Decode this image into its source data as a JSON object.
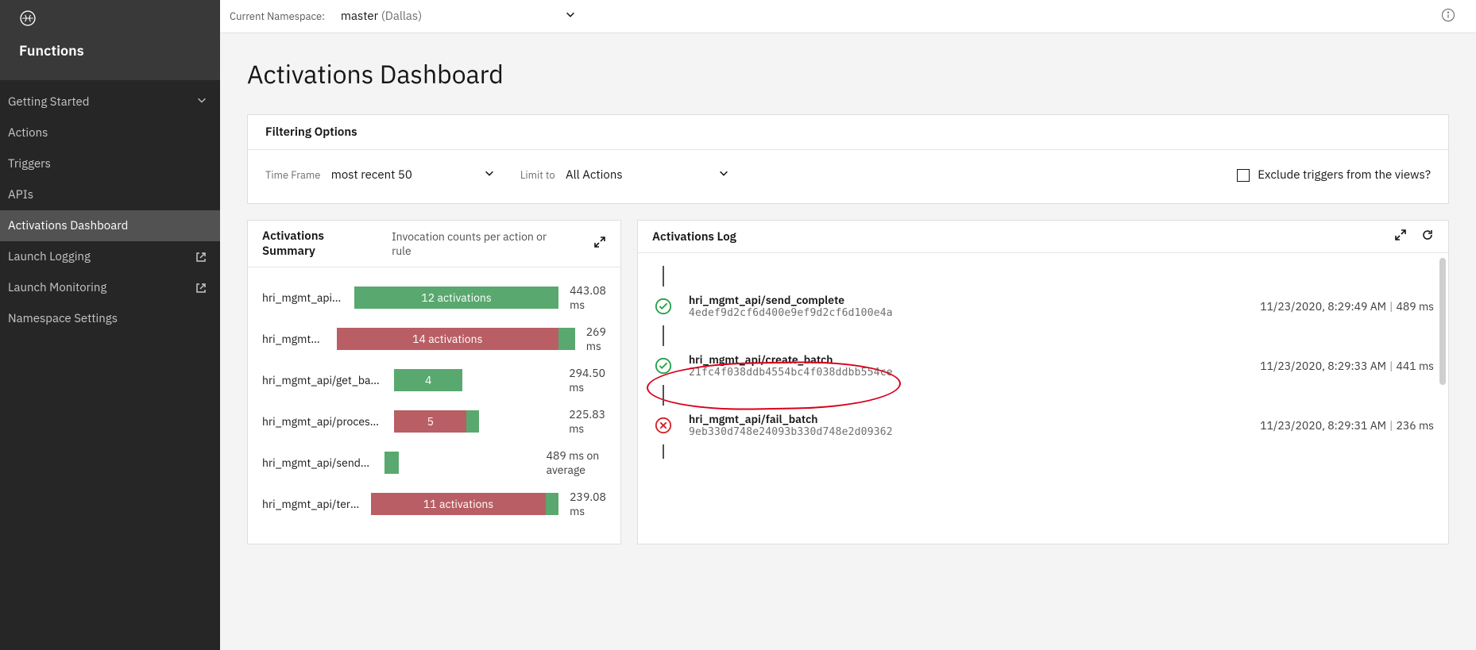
{
  "sidebar": {
    "app": "Functions",
    "items": [
      {
        "label": "Getting Started",
        "chevron": true
      },
      {
        "label": "Actions"
      },
      {
        "label": "Triggers"
      },
      {
        "label": "APIs"
      },
      {
        "label": "Activations Dashboard",
        "selected": true
      },
      {
        "label": "Launch Logging",
        "external": true
      },
      {
        "label": "Launch Monitoring",
        "external": true
      },
      {
        "label": "Namespace Settings"
      }
    ]
  },
  "topbar": {
    "ns_label": "Current Namespace:",
    "ns_value": "master",
    "ns_region": "(Dallas)"
  },
  "page": {
    "title": "Activations Dashboard"
  },
  "filter": {
    "heading": "Filtering Options",
    "timeframe_label": "Time Frame",
    "timeframe_value": "most recent 50",
    "limit_label": "Limit to",
    "limit_value": "All Actions",
    "exclude_label": "Exclude triggers from the views?"
  },
  "summary": {
    "title": "Activations Summary",
    "subtitle": "Invocation counts per action or rule",
    "max": 14,
    "rows": [
      {
        "name": "hri_mgmt_api/create_batch",
        "count": 12,
        "bar_label": "12 activations",
        "avg": "443.08 ms",
        "green_frac": 1.0,
        "red_frac": 0.0
      },
      {
        "name": "hri_mgmt_api/fail_batch",
        "count": 14,
        "bar_label": "14 activations",
        "avg": "269 ms",
        "green_frac": 0.07,
        "red_frac": 0.93,
        "green_tail": true
      },
      {
        "name": "hri_mgmt_api/get_batch_by…",
        "count": 4,
        "bar_label": "4",
        "avg": "294.50 ms",
        "green_frac": 1.0,
        "red_frac": 0.0,
        "small": true
      },
      {
        "name": "hri_mgmt_api/processing_c…",
        "count": 5,
        "bar_label": "5",
        "avg": "225.83 ms",
        "green_frac": 0.15,
        "red_frac": 0.85,
        "small": true,
        "green_tail": true
      },
      {
        "name": "hri_mgmt_api/send_complete",
        "count": 1,
        "bar_label": "",
        "avg": "489 ms on average",
        "green_frac": 1.0,
        "red_frac": 0.0,
        "small": true,
        "tiny": true
      },
      {
        "name": "hri_mgmt_api/terminate_ba…",
        "count": 11,
        "bar_label": "11 activations",
        "avg": "239.08 ms",
        "green_frac": 0.07,
        "red_frac": 0.93,
        "green_tail": true
      }
    ]
  },
  "log": {
    "title": "Activations Log",
    "items": [
      {
        "status": "ok",
        "name": "hri_mgmt_api/send_complete",
        "id": "4edef9d2cf6d400e9ef9d2cf6d100e4a",
        "time": "11/23/2020, 8:29:49 AM",
        "dur": "489 ms"
      },
      {
        "status": "ok",
        "name": "hri_mgmt_api/create_batch",
        "id": "21fc4f038ddb4554bc4f038ddbb554ce",
        "time": "11/23/2020, 8:29:33 AM",
        "dur": "441 ms",
        "annot": true
      },
      {
        "status": "err",
        "name": "hri_mgmt_api/fail_batch",
        "id": "9eb330d748e24093b330d748e2d09362",
        "time": "11/23/2020, 8:29:31 AM",
        "dur": "236 ms"
      }
    ]
  }
}
